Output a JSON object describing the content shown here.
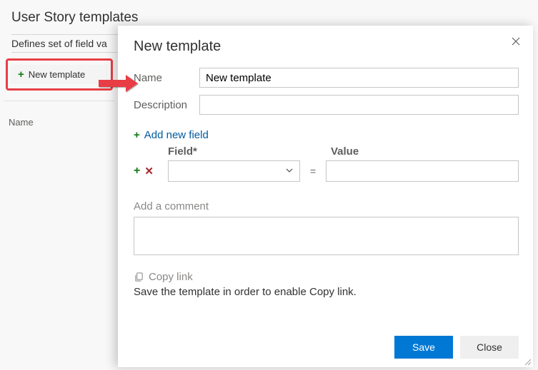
{
  "page": {
    "title": "User Story templates",
    "subtitle": "Defines set of field va",
    "newTemplateBtn": "New template",
    "columnHeader": "Name"
  },
  "modal": {
    "title": "New template",
    "labels": {
      "name": "Name",
      "description": "Description",
      "addField": "Add new field",
      "fieldHeader": "Field*",
      "valueHeader": "Value",
      "equals": "=",
      "comment": "Add a comment",
      "copyLink": "Copy link",
      "copyHint": "Save the template in order to enable Copy link."
    },
    "values": {
      "name": "New template",
      "description": "",
      "fieldSelect": "",
      "fieldValue": "",
      "comment": ""
    },
    "buttons": {
      "save": "Save",
      "close": "Close"
    }
  }
}
